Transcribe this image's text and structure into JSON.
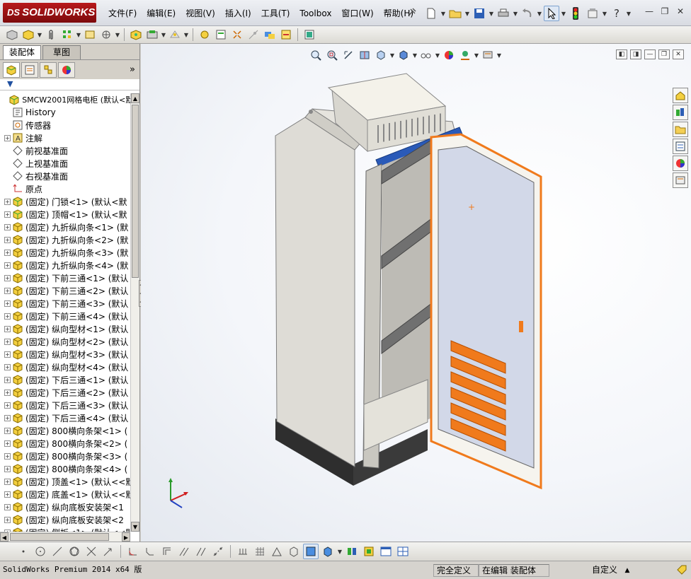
{
  "app": {
    "logo_prefix": "DS",
    "logo_text": "SOLIDWORKS"
  },
  "menu": [
    "文件(F)",
    "编辑(E)",
    "视图(V)",
    "插入(I)",
    "工具(T)",
    "Toolbox",
    "窗口(W)",
    "帮助(H)"
  ],
  "manager_tabs": {
    "assembly": "装配体",
    "sketch": "草图"
  },
  "tree": {
    "root": "SMCW2001网格电柜  (默认<默认",
    "items": [
      {
        "label": "History",
        "expand": false,
        "icon": "history-icon"
      },
      {
        "label": "传感器",
        "expand": false,
        "icon": "sensor-icon"
      },
      {
        "label": "注解",
        "expand": true,
        "icon": "annotation-icon"
      },
      {
        "label": "前视基准面",
        "expand": false,
        "icon": "plane-icon"
      },
      {
        "label": "上视基准面",
        "expand": false,
        "icon": "plane-icon"
      },
      {
        "label": "右视基准面",
        "expand": false,
        "icon": "plane-icon"
      },
      {
        "label": "原点",
        "expand": false,
        "icon": "origin-icon"
      },
      {
        "label": "(固定) 门锁<1> (默认<默",
        "expand": true,
        "icon": "assembly-icon"
      },
      {
        "label": "(固定) 顶帽<1> (默认<默",
        "expand": true,
        "icon": "assembly-icon"
      },
      {
        "label": "(固定) 九折纵向条<1> (默",
        "expand": true,
        "icon": "part-icon"
      },
      {
        "label": "(固定) 九折纵向条<2> (默",
        "expand": true,
        "icon": "part-icon"
      },
      {
        "label": "(固定) 九折纵向条<3> (默",
        "expand": true,
        "icon": "part-icon"
      },
      {
        "label": "(固定) 九折纵向条<4> (默",
        "expand": true,
        "icon": "part-icon"
      },
      {
        "label": "(固定) 下前三通<1> (默认",
        "expand": true,
        "icon": "part-icon"
      },
      {
        "label": "(固定) 下前三通<2> (默认",
        "expand": true,
        "icon": "part-icon"
      },
      {
        "label": "(固定) 下前三通<3> (默认",
        "expand": true,
        "icon": "part-icon"
      },
      {
        "label": "(固定) 下前三通<4> (默认",
        "expand": true,
        "icon": "part-icon"
      },
      {
        "label": "(固定) 纵向型材<1> (默认",
        "expand": true,
        "icon": "part-icon"
      },
      {
        "label": "(固定) 纵向型材<2> (默认",
        "expand": true,
        "icon": "part-icon"
      },
      {
        "label": "(固定) 纵向型材<3> (默认",
        "expand": true,
        "icon": "part-icon"
      },
      {
        "label": "(固定) 纵向型材<4> (默认",
        "expand": true,
        "icon": "part-icon"
      },
      {
        "label": "(固定) 下后三通<1> (默认",
        "expand": true,
        "icon": "part-icon"
      },
      {
        "label": "(固定) 下后三通<2> (默认",
        "expand": true,
        "icon": "part-icon"
      },
      {
        "label": "(固定) 下后三通<3> (默认",
        "expand": true,
        "icon": "part-icon"
      },
      {
        "label": "(固定) 下后三通<4> (默认",
        "expand": true,
        "icon": "part-icon"
      },
      {
        "label": "(固定) 800横向条架<1> (",
        "expand": true,
        "icon": "part-icon"
      },
      {
        "label": "(固定) 800横向条架<2> (",
        "expand": true,
        "icon": "part-icon"
      },
      {
        "label": "(固定) 800横向条架<3> (",
        "expand": true,
        "icon": "part-icon"
      },
      {
        "label": "(固定) 800横向条架<4> (",
        "expand": true,
        "icon": "part-icon"
      },
      {
        "label": "(固定) 顶盖<1> (默认<<默",
        "expand": true,
        "icon": "part-icon"
      },
      {
        "label": "(固定) 底盖<1> (默认<<默",
        "expand": true,
        "icon": "part-icon"
      },
      {
        "label": "(固定) 纵向底板安装架<1",
        "expand": true,
        "icon": "part-icon"
      },
      {
        "label": "(固定) 纵向底板安装架<2",
        "expand": true,
        "icon": "part-icon"
      },
      {
        "label": "(固定) 侧板<1> (默认<<默",
        "expand": true,
        "icon": "part-icon"
      }
    ]
  },
  "status": {
    "product": "SolidWorks Premium 2014 x64 版",
    "definition": "完全定义",
    "mode": "在编辑 装配体",
    "units": "自定义",
    "units_arrow": "▲"
  },
  "colors": {
    "door_orange": "#f07a1c",
    "cabinet_gray": "#e0ded8",
    "rail_blue": "#2a5ab8"
  }
}
